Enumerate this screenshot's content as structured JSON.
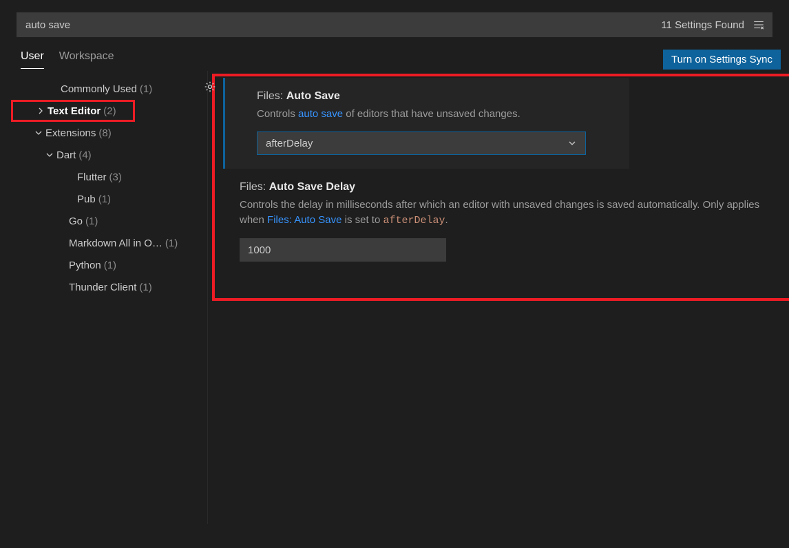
{
  "search": {
    "value": "auto save",
    "results_label": "11 Settings Found"
  },
  "tabs": {
    "user": "User",
    "workspace": "Workspace"
  },
  "sync_button": "Turn on Settings Sync",
  "sidebar": {
    "items": [
      {
        "label": "Commonly Used",
        "count": "(1)",
        "indent": 70,
        "chevron": ""
      },
      {
        "label": "Text Editor",
        "count": "(2)",
        "indent": 48,
        "chevron": "right",
        "highlight": true
      },
      {
        "label": "Extensions",
        "count": "(8)",
        "indent": 48,
        "chevron": "down"
      },
      {
        "label": "Dart",
        "count": "(4)",
        "indent": 64,
        "chevron": "down"
      },
      {
        "label": "Flutter",
        "count": "(3)",
        "indent": 94,
        "chevron": ""
      },
      {
        "label": "Pub",
        "count": "(1)",
        "indent": 94,
        "chevron": ""
      },
      {
        "label": "Go",
        "count": "(1)",
        "indent": 82,
        "chevron": ""
      },
      {
        "label": "Markdown All in O…",
        "count": "(1)",
        "indent": 82,
        "chevron": ""
      },
      {
        "label": "Python",
        "count": "(1)",
        "indent": 82,
        "chevron": ""
      },
      {
        "label": "Thunder Client",
        "count": "(1)",
        "indent": 82,
        "chevron": ""
      }
    ]
  },
  "settings": {
    "auto_save": {
      "category": "Files:",
      "name": "Auto Save",
      "desc_pre": "Controls ",
      "desc_link": "auto save",
      "desc_post": " of editors that have unsaved changes.",
      "value": "afterDelay"
    },
    "auto_save_delay": {
      "category": "Files:",
      "name": "Auto Save Delay",
      "desc_pre": "Controls the delay in milliseconds after which an editor with unsaved changes is saved automatically. Only applies when ",
      "desc_link": "Files: Auto Save",
      "desc_mid": " is set to ",
      "desc_code": "afterDelay",
      "desc_post": ".",
      "value": "1000"
    }
  }
}
